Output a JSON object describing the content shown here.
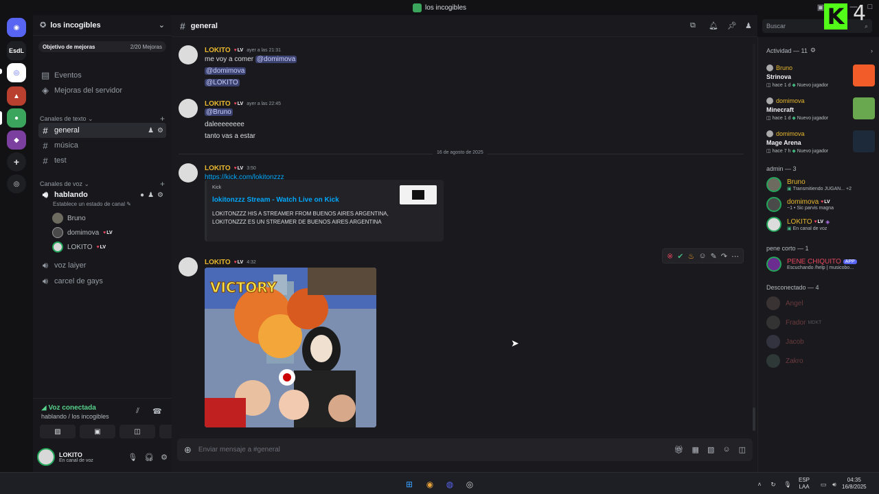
{
  "window": {
    "title": "los incogibles"
  },
  "servers": {
    "esdl_label": "EsdL"
  },
  "sidebar": {
    "server_name": "los incogibles",
    "goal_label": "Objetivo de mejoras",
    "goal_count": "2/20 Mejoras",
    "nav": [
      "Eventos",
      "Mejoras del servidor"
    ],
    "text_category": "Canales de texto",
    "text_channels": [
      "general",
      "música",
      "test"
    ],
    "voice_category": "Canales de voz",
    "voice_channel": "hablando",
    "voice_status": "Establece un estado de canal",
    "voice_users": [
      {
        "name": "Bruno",
        "badge": false
      },
      {
        "name": "domimova",
        "badge": true
      },
      {
        "name": "LOKITO",
        "badge": true
      }
    ],
    "other_voice": [
      "voz laiyer",
      "carcel de gays"
    ]
  },
  "badge_label": "LV",
  "voice_panel": {
    "title": "Voz conectada",
    "subtitle": "hablando / los incogibles"
  },
  "user": {
    "name": "LOKITO",
    "status": "En canal de voz"
  },
  "channel": {
    "name": "general",
    "placeholder": "Enviar mensaje a #general"
  },
  "messages": [
    {
      "author": "LOKITO",
      "time": "ayer a las 21:31",
      "lines": [
        "me voy a comer @domimova",
        "@domimova",
        "@LOKITO"
      ]
    },
    {
      "author": "LOKITO",
      "time": "ayer a las 22:45",
      "lines": [
        "@Bruno",
        "daleeeeeeee",
        "tanto vas a estar"
      ]
    },
    {
      "author": "LOKITO",
      "time": "3:50",
      "link": "https://kick.com/lokitonzzz",
      "embed": {
        "provider": "Kick",
        "title": "lokitonzzz Stream - Watch Live on Kick",
        "description": "LOKITONZZZ HIS A STREAMER FROM BUENOS AIRES ARGENTINA, LOKITONZZZ ES UN STREAMER DE BUENOS AIRES ARGENTINA"
      }
    },
    {
      "author": "LOKITO",
      "time": "4:32",
      "image_text": "VICTORY"
    }
  ],
  "date_divider": "16 de agosto de 2025",
  "search": {
    "placeholder": "Buscar"
  },
  "members": {
    "activity_header": "Actividad — 11",
    "activities": [
      {
        "name": "Bruno",
        "game": "Strinova",
        "time": "hace 1 d",
        "tag": "Nuevo jugador"
      },
      {
        "name": "domimova",
        "game": "Minecraft",
        "time": "hace 1 d",
        "tag": "Nuevo jugador"
      },
      {
        "name": "domimova",
        "game": "Mage Arena",
        "time": "hace 7 h",
        "tag": "Nuevo jugador"
      }
    ],
    "admin_header": "admin — 3",
    "admins": [
      {
        "name": "Bruno",
        "status": "Transmitiendo JUGAN...",
        "extra": "+2"
      },
      {
        "name": "domimova",
        "status": "~1 • Sic parvis magna"
      },
      {
        "name": "LOKITO",
        "status": "En canal de voz"
      }
    ],
    "pene_header": "pene corto — 1",
    "pene": [
      {
        "name": "PENE CHIQUITO",
        "tag": "APP",
        "status": "Escuchando /help | musicobo..."
      }
    ],
    "offline_header": "Desconectado — 4",
    "offline": [
      {
        "name": "Angel"
      },
      {
        "name": "Frador",
        "tag": "MDKT"
      },
      {
        "name": "Jacob"
      },
      {
        "name": "Zakro"
      }
    ]
  },
  "taskbar": {
    "lang1": "ESP",
    "lang2": "LAA",
    "time": "04:35",
    "date": "16/8/2025"
  },
  "colors": {
    "accent": "#5865f2",
    "name": "#e9b82e",
    "online": "#23a55a",
    "kick": "#53fc18"
  }
}
